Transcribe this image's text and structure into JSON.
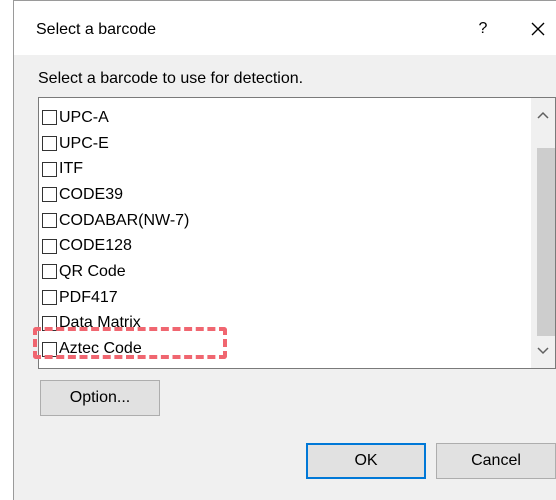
{
  "dialog": {
    "title": "Select a barcode",
    "help_label": "?",
    "close_label": "✕"
  },
  "instruction": "Select a barcode to use for detection.",
  "barcodes": [
    {
      "label": "UPC-A",
      "checked": false
    },
    {
      "label": "UPC-E",
      "checked": false
    },
    {
      "label": "ITF",
      "checked": false
    },
    {
      "label": "CODE39",
      "checked": false
    },
    {
      "label": "CODABAR(NW-7)",
      "checked": false
    },
    {
      "label": "CODE128",
      "checked": false
    },
    {
      "label": "QR Code",
      "checked": false
    },
    {
      "label": "PDF417",
      "checked": false
    },
    {
      "label": "Data Matrix",
      "checked": false
    },
    {
      "label": "Aztec Code",
      "checked": false
    }
  ],
  "buttons": {
    "option": "Option...",
    "ok": "OK",
    "cancel": "Cancel"
  },
  "colors": {
    "highlight": "#f06670",
    "default_button_border": "#0078d7"
  }
}
